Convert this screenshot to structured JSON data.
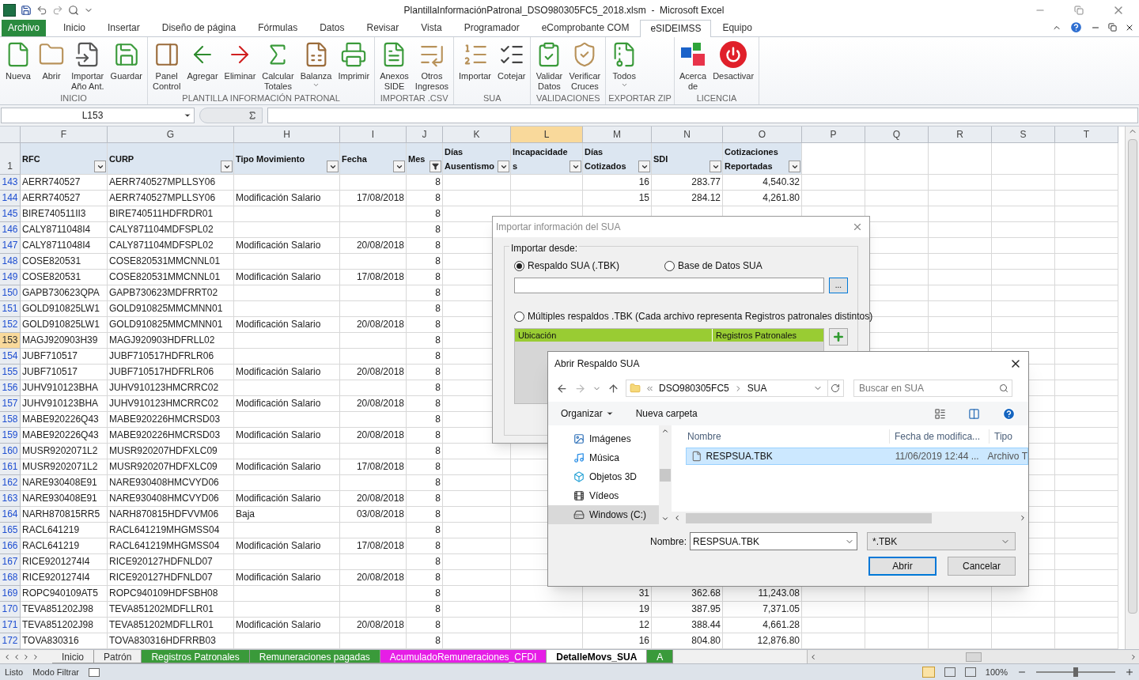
{
  "window": {
    "title": "PlantillaInformaciónPatronal_DSO980305FC5_2018.xlsm  -  Microsoft Excel"
  },
  "ribbon_tabs": [
    {
      "label": "Archivo",
      "kind": "file",
      "selected": false
    },
    {
      "label": "Inicio",
      "kind": "tab",
      "selected": false
    },
    {
      "label": "Insertar",
      "kind": "tab",
      "selected": false
    },
    {
      "label": "Diseño de página",
      "kind": "tab",
      "selected": false
    },
    {
      "label": "Fórmulas",
      "kind": "tab",
      "selected": false
    },
    {
      "label": "Datos",
      "kind": "tab",
      "selected": false
    },
    {
      "label": "Revisar",
      "kind": "tab",
      "selected": false
    },
    {
      "label": "Vista",
      "kind": "tab",
      "selected": false
    },
    {
      "label": "Programador",
      "kind": "tab",
      "selected": false
    },
    {
      "label": "eComprobante COM",
      "kind": "tab",
      "selected": false
    },
    {
      "label": "eSIDEIMSS",
      "kind": "tab",
      "selected": true
    },
    {
      "label": "Equipo",
      "kind": "tab",
      "selected": false
    }
  ],
  "ribbon_groups": [
    {
      "label": "INICIO",
      "buttons": [
        {
          "lines": [
            "Nueva"
          ],
          "dropdown": false
        },
        {
          "lines": [
            "Abrir"
          ],
          "dropdown": false
        },
        {
          "lines": [
            "Importar",
            "Año Ant."
          ],
          "dropdown": false
        },
        {
          "lines": [
            "Guardar"
          ],
          "dropdown": false
        }
      ]
    },
    {
      "label": "PLANTILLA INFORMACIÓN PATRONAL",
      "buttons": [
        {
          "lines": [
            "Panel",
            "Control"
          ],
          "dropdown": false
        },
        {
          "lines": [
            "Agregar"
          ],
          "dropdown": false
        },
        {
          "lines": [
            "Eliminar"
          ],
          "dropdown": false
        },
        {
          "lines": [
            "Calcular",
            "Totales"
          ],
          "dropdown": false
        },
        {
          "lines": [
            "Balanza"
          ],
          "dropdown": true
        },
        {
          "lines": [
            "Imprimir"
          ],
          "dropdown": false
        }
      ]
    },
    {
      "label": "IMPORTAR .CSV",
      "buttons": [
        {
          "lines": [
            "Anexos",
            "SIDE"
          ],
          "dropdown": false
        },
        {
          "lines": [
            "Otros",
            "Ingresos"
          ],
          "dropdown": false
        }
      ]
    },
    {
      "label": "SUA",
      "buttons": [
        {
          "lines": [
            "Importar"
          ],
          "dropdown": false
        },
        {
          "lines": [
            "Cotejar"
          ],
          "dropdown": false
        }
      ]
    },
    {
      "label": "VALIDACIONES",
      "buttons": [
        {
          "lines": [
            "Validar",
            "Datos"
          ],
          "dropdown": false
        },
        {
          "lines": [
            "Verificar",
            "Cruces"
          ],
          "dropdown": false
        }
      ]
    },
    {
      "label": "EXPORTAR ZIP",
      "buttons": [
        {
          "lines": [
            "Todos"
          ],
          "dropdown": true
        }
      ]
    },
    {
      "label": "LICENCIA",
      "buttons": [
        {
          "lines": [
            "Acerca",
            "de"
          ],
          "dropdown": false
        },
        {
          "lines": [
            "Desactivar"
          ],
          "dropdown": false
        }
      ]
    }
  ],
  "formula_bar": {
    "name_box": "L153"
  },
  "sheet": {
    "header_row": "1",
    "columns": [
      {
        "letter": "F",
        "label": "RFC",
        "filtered": false,
        "selected": false
      },
      {
        "letter": "G",
        "label": "CURP",
        "filtered": false,
        "selected": false
      },
      {
        "letter": "H",
        "label": "Tipo Movimiento",
        "filtered": false,
        "selected": false
      },
      {
        "letter": "I",
        "label": "Fecha",
        "filtered": false,
        "selected": false
      },
      {
        "letter": "J",
        "label": "Mes",
        "filtered": true,
        "selected": false
      },
      {
        "letter": "K",
        "label": "Días Ausentismo",
        "filtered": false,
        "selected": false
      },
      {
        "letter": "L",
        "label": "Incapacidades",
        "filtered": false,
        "selected": true
      },
      {
        "letter": "M",
        "label": "Días Cotizados",
        "filtered": false,
        "selected": false
      },
      {
        "letter": "N",
        "label": "SDI",
        "filtered": false,
        "selected": false
      },
      {
        "letter": "O",
        "label": "Cotizaciones Reportadas",
        "filtered": false,
        "selected": false
      }
    ],
    "extra_columns": [
      "P",
      "Q",
      "R",
      "S",
      "T"
    ],
    "rows": [
      {
        "number": "143",
        "selected": false,
        "F": "AERR740527",
        "G": "AERR740527MPLLSY06",
        "J": "8",
        "M": "16",
        "N": "283.77",
        "O": "4,540.32"
      },
      {
        "number": "144",
        "selected": false,
        "F": "AERR740527",
        "G": "AERR740527MPLLSY06",
        "H": "Modificación Salario",
        "I": "17/08/2018",
        "J": "8",
        "M": "15",
        "N": "284.12",
        "O": "4,261.80"
      },
      {
        "number": "145",
        "selected": false,
        "F": "BIRE740511II3",
        "G": "BIRE740511HDFRDR01",
        "J": "8"
      },
      {
        "number": "146",
        "selected": false,
        "F": "CALY8711048I4",
        "G": "CALY871104MDFSPL02",
        "J": "8"
      },
      {
        "number": "147",
        "selected": false,
        "F": "CALY8711048I4",
        "G": "CALY871104MDFSPL02",
        "H": "Modificación Salario",
        "I": "20/08/2018",
        "J": "8"
      },
      {
        "number": "148",
        "selected": false,
        "F": "COSE820531",
        "G": "COSE820531MMCNNL01",
        "J": "8"
      },
      {
        "number": "149",
        "selected": false,
        "F": "COSE820531",
        "G": "COSE820531MMCNNL01",
        "H": "Modificación Salario",
        "I": "17/08/2018",
        "J": "8"
      },
      {
        "number": "150",
        "selected": false,
        "F": "GAPB730623QPA",
        "G": "GAPB730623MDFRRT02",
        "J": "8"
      },
      {
        "number": "151",
        "selected": false,
        "F": "GOLD910825LW1",
        "G": "GOLD910825MMCMNN01",
        "J": "8"
      },
      {
        "number": "152",
        "selected": false,
        "F": "GOLD910825LW1",
        "G": "GOLD910825MMCMNN01",
        "H": "Modificación Salario",
        "I": "20/08/2018",
        "J": "8"
      },
      {
        "number": "153",
        "selected": true,
        "F": "MAGJ920903H39",
        "G": "MAGJ920903HDFRLL02",
        "J": "8"
      },
      {
        "number": "154",
        "selected": false,
        "F": "JUBF710517",
        "G": "JUBF710517HDFRLR06",
        "J": "8"
      },
      {
        "number": "155",
        "selected": false,
        "F": "JUBF710517",
        "G": "JUBF710517HDFRLR06",
        "H": "Modificación Salario",
        "I": "20/08/2018",
        "J": "8"
      },
      {
        "number": "156",
        "selected": false,
        "F": "JUHV910123BHA",
        "G": "JUHV910123HMCRRC02",
        "J": "8"
      },
      {
        "number": "157",
        "selected": false,
        "F": "JUHV910123BHA",
        "G": "JUHV910123HMCRRC02",
        "H": "Modificación Salario",
        "I": "20/08/2018",
        "J": "8"
      },
      {
        "number": "158",
        "selected": false,
        "F": "MABE920226Q43",
        "G": "MABE920226HMCRSD03",
        "J": "8"
      },
      {
        "number": "159",
        "selected": false,
        "F": "MABE920226Q43",
        "G": "MABE920226HMCRSD03",
        "H": "Modificación Salario",
        "I": "20/08/2018",
        "J": "8"
      },
      {
        "number": "160",
        "selected": false,
        "F": "MUSR9202071L2",
        "G": "MUSR920207HDFXLC09",
        "J": "8"
      },
      {
        "number": "161",
        "selected": false,
        "F": "MUSR9202071L2",
        "G": "MUSR920207HDFXLC09",
        "H": "Modificación Salario",
        "I": "17/08/2018",
        "J": "8"
      },
      {
        "number": "162",
        "selected": false,
        "F": "NARE930408E91",
        "G": "NARE930408HMCVYD06",
        "J": "8"
      },
      {
        "number": "163",
        "selected": false,
        "F": "NARE930408E91",
        "G": "NARE930408HMCVYD06",
        "H": "Modificación Salario",
        "I": "20/08/2018",
        "J": "8"
      },
      {
        "number": "164",
        "selected": false,
        "F": "NARH870815RR5",
        "G": "NARH870815HDFVVM06",
        "H": "Baja",
        "I": "03/08/2018",
        "J": "8"
      },
      {
        "number": "165",
        "selected": false,
        "F": "RACL641219",
        "G": "RACL641219MHGMSS04",
        "J": "8"
      },
      {
        "number": "166",
        "selected": false,
        "F": "RACL641219",
        "G": "RACL641219MHGMSS04",
        "H": "Modificación Salario",
        "I": "17/08/2018",
        "J": "8"
      },
      {
        "number": "167",
        "selected": false,
        "F": "RICE9201274I4",
        "G": "RICE920127HDFNLD07",
        "J": "8"
      },
      {
        "number": "168",
        "selected": false,
        "F": "RICE9201274I4",
        "G": "RICE920127HDFNLD07",
        "H": "Modificación Salario",
        "I": "20/08/2018",
        "J": "8"
      },
      {
        "number": "169",
        "selected": false,
        "F": "ROPC940109AT5",
        "G": "ROPC940109HDFSBH08",
        "J": "8",
        "M": "31",
        "N": "362.68",
        "O": "11,243.08"
      },
      {
        "number": "170",
        "selected": false,
        "F": "TEVA851202J98",
        "G": "TEVA851202MDFLLR01",
        "J": "8",
        "M": "19",
        "N": "387.95",
        "O": "7,371.05"
      },
      {
        "number": "171",
        "selected": false,
        "F": "TEVA851202J98",
        "G": "TEVA851202MDFLLR01",
        "H": "Modificación Salario",
        "I": "20/08/2018",
        "J": "8",
        "M": "12",
        "N": "388.44",
        "O": "4,661.28"
      },
      {
        "number": "172",
        "selected": false,
        "F": "TOVA830316",
        "G": "TOVA830316HDFRRB03",
        "J": "8",
        "M": "16",
        "N": "804.80",
        "O": "12,876.80"
      }
    ]
  },
  "sheet_tabs": [
    {
      "label": "Inicio",
      "color": "#f0f0f0",
      "selected": false
    },
    {
      "label": "Patrón",
      "color": "#f0f0f0",
      "selected": false
    },
    {
      "label": "Registros Patronales",
      "color": "#3a9a3a",
      "selected": false
    },
    {
      "label": "Remuneraciones pagadas",
      "color": "#3a9a3a",
      "selected": false
    },
    {
      "label": "AcumuladoRemuneraciones_CFDI",
      "color": "#e61ee6",
      "selected": false
    },
    {
      "label": "DetalleMovs_SUA",
      "color": "#ffffff",
      "selected": true
    },
    {
      "label": "A",
      "color": "#3a9a3a",
      "selected": false
    }
  ],
  "status_bar": {
    "mode": "Listo",
    "filter_mode": "Modo Filtrar",
    "zoom": "100%",
    "zoom_level": {
      "level": 0.5
    }
  },
  "import_dialog": {
    "title": "Importar información del SUA",
    "group_label": "Importar desde:",
    "source_options": [
      {
        "label": "Respaldo SUA (.TBK)",
        "selected": true
      },
      {
        "label": "Base de Datos SUA",
        "selected": false
      }
    ],
    "browse_button": "...",
    "multiple_option": {
      "label": "Múltiples respaldos .TBK (Cada archivo representa Registros patronales distintos)",
      "selected": false
    },
    "table_columns": [
      "Ubicación",
      "Registros Patronales"
    ]
  },
  "open_dialog": {
    "title": "Abrir Respaldo SUA",
    "breadcrumb": [
      "DSO980305FC5",
      "SUA"
    ],
    "search": {
      "placeholder": "Buscar en SUA"
    },
    "toolbar": [
      "Organizar",
      "Nueva carpeta"
    ],
    "nav_items": [
      {
        "label": "Imágenes",
        "selected": false
      },
      {
        "label": "Música",
        "selected": false
      },
      {
        "label": "Objetos 3D",
        "selected": false
      },
      {
        "label": "Vídeos",
        "selected": false
      },
      {
        "label": "Windows (C:)",
        "selected": true
      }
    ],
    "columns": [
      "Nombre",
      "Fecha de modifica...",
      "Tipo"
    ],
    "files": [
      {
        "name": "RESPSUA.TBK",
        "date": "11/06/2019 12:44 ...",
        "type": "Archivo T",
        "selected": true
      }
    ],
    "filename_label": "Nombre:",
    "filename": "RESPSUA.TBK",
    "filter": "*.TBK",
    "buttons": [
      {
        "label": "Abrir",
        "default": true
      },
      {
        "label": "Cancelar",
        "default": false
      }
    ]
  }
}
